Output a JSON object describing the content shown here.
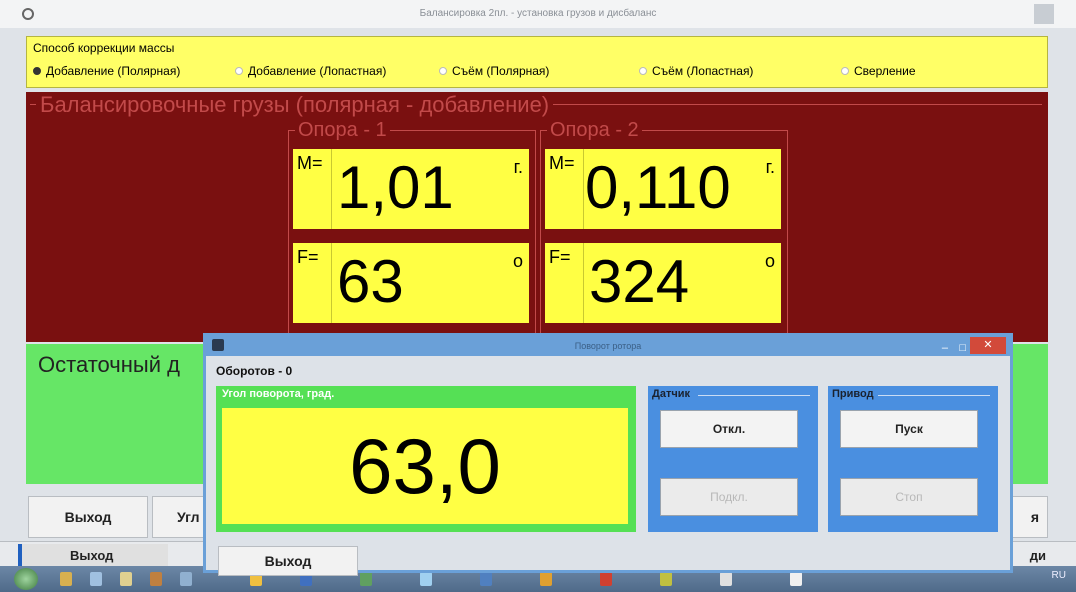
{
  "main_window": {
    "title": "Балансировка 2пл. - установка грузов и дисбаланс"
  },
  "correction_mode": {
    "caption": "Способ коррекции массы",
    "options": [
      {
        "label": "Добавление (Полярная)",
        "selected": true
      },
      {
        "label": "Добавление (Лопастная)",
        "selected": false
      },
      {
        "label": "Съём (Полярная)",
        "selected": false
      },
      {
        "label": "Съём (Лопастная)",
        "selected": false
      },
      {
        "label": "Сверление",
        "selected": false
      }
    ]
  },
  "weights": {
    "legend": "Балансировочные грузы (полярная - добавление)",
    "supports": [
      {
        "title": "Опора - 1",
        "mass_prefix": "M=",
        "mass_value": "1,01",
        "mass_unit": "г.",
        "angle_prefix": "F=",
        "angle_value": "63",
        "angle_unit": "o"
      },
      {
        "title": "Опора - 2",
        "mass_prefix": "M=",
        "mass_value": "0,110",
        "mass_unit": "г.",
        "angle_prefix": "F=",
        "angle_value": "324",
        "angle_unit": "o"
      }
    ]
  },
  "residual": {
    "title": "Остаточный д"
  },
  "bottom_buttons": {
    "exit": "Выход",
    "angle": "Угл",
    "right_partial": "я"
  },
  "statusbar": {
    "left": "Выход",
    "right": "ди"
  },
  "dialog": {
    "title": "Поворот ротора",
    "revolutions": "Оборотов - 0",
    "angle_caption": "Угол поворота, град.",
    "angle_value": "63,0",
    "sensor": {
      "caption": "Датчик",
      "off_label": "Откл.",
      "on_label": "Подкл."
    },
    "drive": {
      "caption": "Привод",
      "start_label": "Пуск",
      "stop_label": "Стоп"
    },
    "exit_label": "Выход",
    "close_glyph": "✕",
    "min_glyph": "–",
    "max_glyph": "□"
  },
  "taskbar": {
    "tray_text": "RU"
  }
}
